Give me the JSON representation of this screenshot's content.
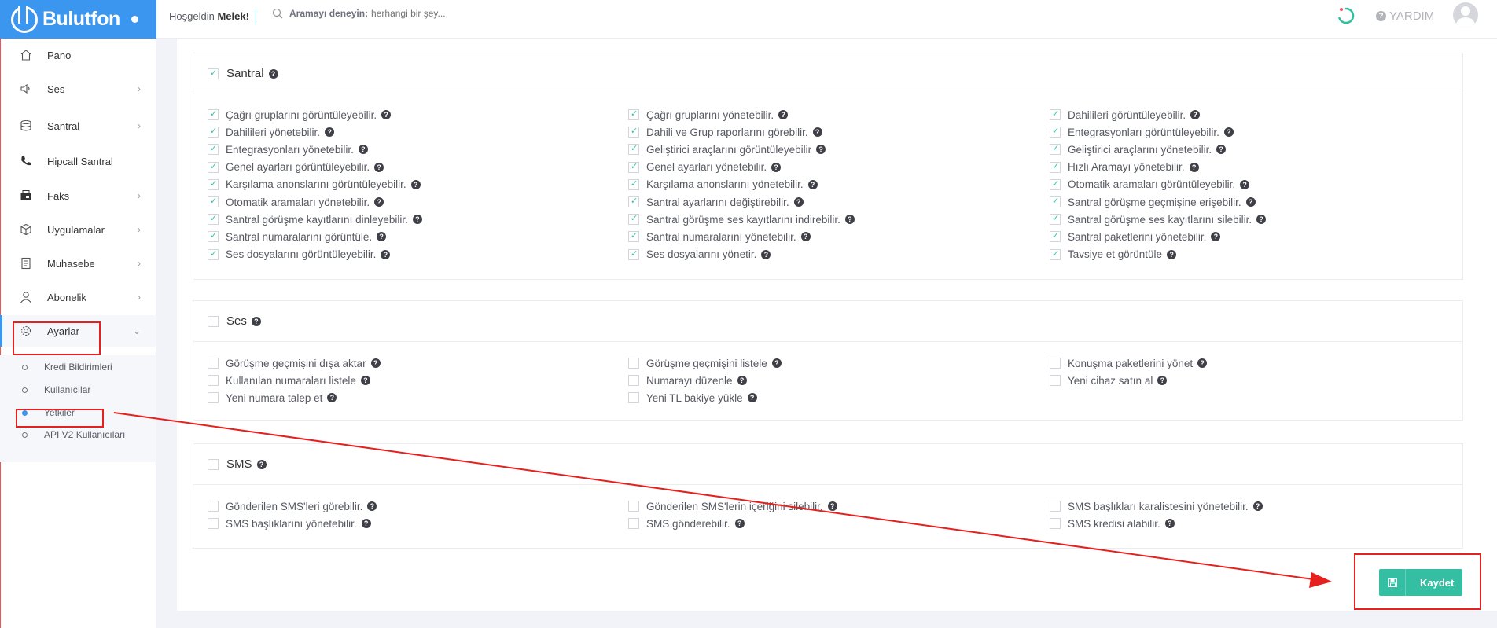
{
  "brand": {
    "name": "Bulutfon"
  },
  "header": {
    "welcome_prefix": "Hoşgeldin",
    "user_name": "Melek!",
    "search_label": "Aramayı deneyin:",
    "search_placeholder": "herhangi bir şey...",
    "help_label": "YARDIM"
  },
  "sidebar": {
    "items": [
      {
        "label": "Pano"
      },
      {
        "label": "Ses"
      },
      {
        "label": "Santral"
      },
      {
        "label": "Hipcall Santral"
      },
      {
        "label": "Faks"
      },
      {
        "label": "Uygulamalar"
      },
      {
        "label": "Muhasebe"
      },
      {
        "label": "Abonelik"
      },
      {
        "label": "Ayarlar"
      }
    ],
    "subitems": [
      {
        "label": "Kredi Bildirimleri"
      },
      {
        "label": "Kullanıcılar"
      },
      {
        "label": "Yetkiler"
      },
      {
        "label": "API V2 Kullanıcıları"
      }
    ]
  },
  "sections": {
    "santral": {
      "title": "Santral",
      "checked": true,
      "perms": [
        "Çağrı gruplarını görüntüleyebilir.",
        "Çağrı gruplarını yönetebilir.",
        "Dahilileri görüntüleyebilir.",
        "Dahilileri yönetebilir.",
        "Dahili ve Grup raporlarını görebilir.",
        "Entegrasyonları görüntüleyebilir.",
        "Entegrasyonları yönetebilir.",
        "Geliştirici araçlarını görüntüleyebilir",
        "Geliştirici araçlarını yönetebilir.",
        "Genel ayarları görüntüleyebilir.",
        "Genel ayarları yönetebilir.",
        "Hızlı Aramayı yönetebilir.",
        "Karşılama anonslarını görüntüleyebilir.",
        "Karşılama anonslarını yönetebilir.",
        "Otomatik aramaları görüntüleyebilir.",
        "Otomatik aramaları yönetebilir.",
        "Santral ayarlarını değiştirebilir.",
        "Santral görüşme geçmişine erişebilir.",
        "Santral görüşme kayıtlarını dinleyebilir.",
        "Santral görüşme ses kayıtlarını indirebilir.",
        "Santral görüşme ses kayıtlarını silebilir.",
        "Santral numaralarını görüntüle.",
        "Santral numaralarını yönetebilir.",
        "Santral paketlerini yönetebilir.",
        "Ses dosyalarını görüntüleyebilir.",
        "Ses dosyalarını yönetir.",
        "Tavsiye et görüntüle"
      ]
    },
    "ses": {
      "title": "Ses",
      "checked": false,
      "perms": [
        "Görüşme geçmişini dışa aktar",
        "Görüşme geçmişini listele",
        "Konuşma paketlerini yönet",
        "Kullanılan numaraları listele",
        "Numarayı düzenle",
        "Yeni cihaz satın al",
        "Yeni numara talep et",
        "Yeni TL bakiye yükle"
      ]
    },
    "sms": {
      "title": "SMS",
      "checked": false,
      "perms": [
        "Gönderilen SMS'leri görebilir.",
        "Gönderilen SMS'lerin içeriğini silebilir.",
        "SMS başlıkları karalistesini yönetebilir.",
        "SMS başlıklarını yönetebilir.",
        "SMS gönderebilir.",
        "SMS kredisi alabilir."
      ]
    }
  },
  "save_label": "Kaydet",
  "colors": {
    "brand": "#3b96ef",
    "accent": "#34bfa3",
    "annotation": "#e5201e"
  }
}
